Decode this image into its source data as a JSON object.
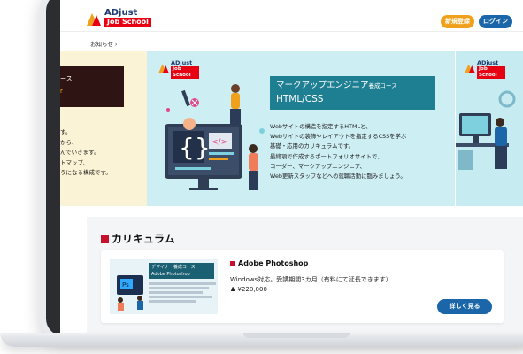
{
  "header": {
    "logo_brand": "ADjust",
    "logo_sub": "Job School",
    "signup_label": "新規登録",
    "login_label": "ログイン"
  },
  "nav": {
    "news_label": "お知らせ ›"
  },
  "carousel": {
    "left_slide": {
      "dark_line1": "ース",
      "dark_line2": "r",
      "body_lines": [
        "す。",
        "から、",
        "んでいきます。",
        "トマップ、",
        "うになる構成です。"
      ]
    },
    "main_slide": {
      "logo_brand": "ADjust",
      "logo_sub": "Job School",
      "title_main": "マークアップエンジニア",
      "title_suffix": "養成コース",
      "subtitle": "HTML/CSS",
      "desc_lines": [
        "Webサイトの構造を指定するHTMLと、",
        "Webサイトの装飾やレイアウトを指定するCSSを学ぶ",
        "基礎・応用のカリキュラムです。",
        "最終項で作成するポートフォリオサイトで、",
        "コーダー、マークアップエンジニア、",
        "Web更新スタッフなどへの就職活動に臨みましょう。"
      ]
    },
    "right_slide": {
      "logo_brand": "ADjust",
      "logo_sub": "Job School"
    },
    "dots": 5,
    "active_dot": 0
  },
  "curriculum": {
    "title": "カリキュラム",
    "courses": [
      {
        "name": "Adobe Photoshop",
        "description": "Windows対応。受講期間3カ月（有料にて延長できます）",
        "price": "¥220,000",
        "more_label": "詳しく見る",
        "thumb_header": "デザイナー養成コース",
        "thumb_title": "Adobe Photoshop"
      }
    ]
  },
  "colors": {
    "accent_blue": "#1a66a8",
    "accent_orange": "#f0a01b",
    "brand_red": "#e60012",
    "slide_teal": "#1f7f92"
  }
}
